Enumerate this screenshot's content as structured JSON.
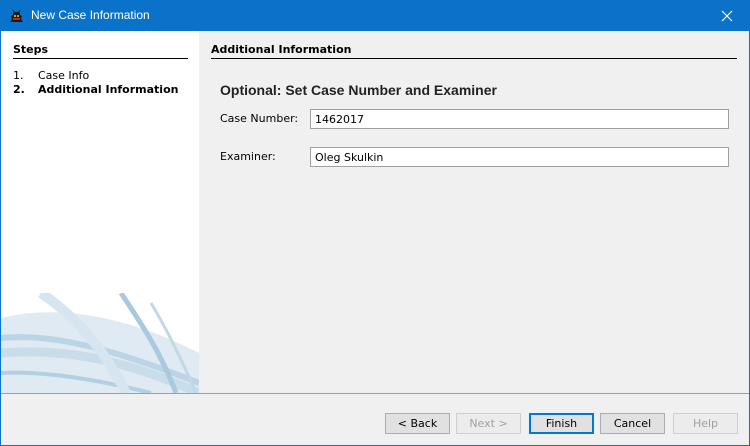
{
  "window": {
    "title": "New Case Information",
    "close_icon": "close-icon",
    "app_icon": "autopsy-app-icon"
  },
  "steps": {
    "title": "Steps",
    "items": [
      {
        "num": "1.",
        "label": "Case Info",
        "current": false
      },
      {
        "num": "2.",
        "label": "Additional Information",
        "current": true
      }
    ]
  },
  "panel": {
    "section_title": "Additional Information",
    "heading": "Optional: Set Case Number and Examiner",
    "case_number_label": "Case Number:",
    "case_number_value": "1462017",
    "examiner_label": "Examiner:",
    "examiner_value": "Oleg Skulkin"
  },
  "buttons": {
    "back": "< Back",
    "next": "Next >",
    "finish": "Finish",
    "cancel": "Cancel",
    "help": "Help"
  },
  "colors": {
    "titlebar": "#0b72c9",
    "focus": "#0078d7",
    "swoosh": "#a9c9de"
  }
}
